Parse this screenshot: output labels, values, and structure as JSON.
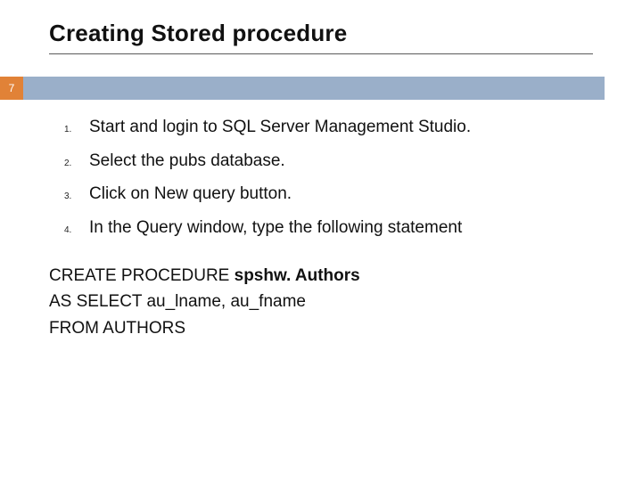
{
  "title": "Creating Stored procedure",
  "page_badge": "7",
  "steps": {
    "n1": "1.",
    "t1": "Start and login to SQL Server Management Studio.",
    "n2": "2.",
    "t2": "Select the pubs database.",
    "n3": "3.",
    "t3": "Click on New query button.",
    "n4": "4.",
    "t4": "In the Query window, type the following statement"
  },
  "code": {
    "line1_a": "CREATE PROCEDURE ",
    "line1_b": "spshw. Authors",
    "line2": "AS SELECT au_lname, au_fname",
    "line3": "FROM AUTHORS"
  }
}
